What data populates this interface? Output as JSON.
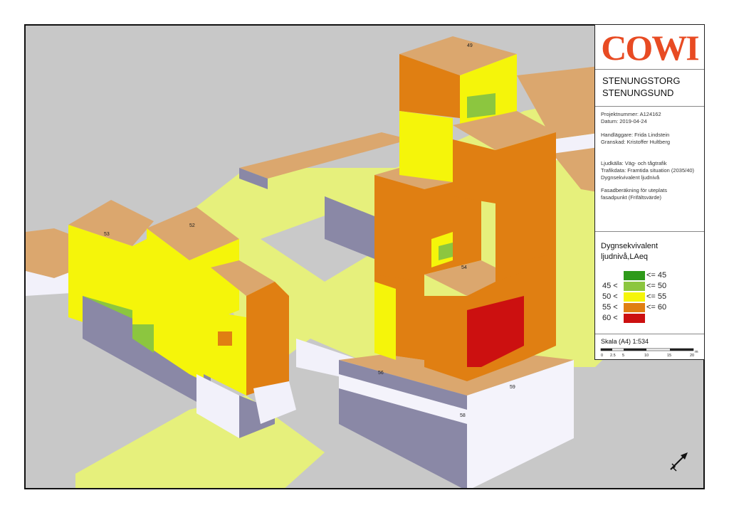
{
  "logo": {
    "text": "COWI",
    "color": "#e84b23"
  },
  "project": {
    "line1": "STENUNGSTORG",
    "line2": "STENUNGSUND"
  },
  "info": [
    "Projektnummer: A124162",
    "Datum: 2019-04-24",
    "Handläggare: Frida Lindstein",
    "Granskad: Kristoffer Hultberg",
    "Ljudkälla: Väg- och tågtrafik",
    "Trafikdata: Framtida situation (2035/40)",
    "Dygnsekvivalent ljudnivå",
    "Fasadberäkning för uteplats",
    "fasadpunkt (Frifältsvärde)"
  ],
  "legend": {
    "title_line1": "Dygnsekvivalent",
    "title_line2": "ljudnivå,LAeq",
    "classes": [
      {
        "lo": "",
        "hi": "<= 45",
        "color": "#2e9a1a"
      },
      {
        "lo": "45 <",
        "hi": "<= 50",
        "color": "#8cc63f"
      },
      {
        "lo": "50 <",
        "hi": "<= 55",
        "color": "#f5f50a"
      },
      {
        "lo": "55 <",
        "hi": "<= 60",
        "color": "#e07f12"
      },
      {
        "lo": "60 <",
        "hi": "",
        "color": "#cc1010"
      }
    ]
  },
  "scale": {
    "label": "Skala (A4) 1:534",
    "ticks": [
      "0",
      "2.5",
      "5",
      "10",
      "15",
      "20"
    ],
    "unit": "m"
  },
  "map_labels": [
    {
      "text": "49",
      "id": "tower-roof"
    },
    {
      "text": "53",
      "id": "lowleft-roof"
    },
    {
      "text": "52",
      "id": "midleft-roof"
    },
    {
      "text": "56",
      "id": "podium-left"
    },
    {
      "text": "59",
      "id": "podium-right"
    },
    {
      "text": "58",
      "id": "podium-front"
    },
    {
      "text": "54",
      "id": "tower-step"
    }
  ],
  "colors": {
    "roof": "#dba76e",
    "ground_green": "#e4ef7a",
    "shadow_wall": "#8a88a6",
    "podium_wall": "#f4f3fb",
    "background": "#c8c8c8"
  }
}
